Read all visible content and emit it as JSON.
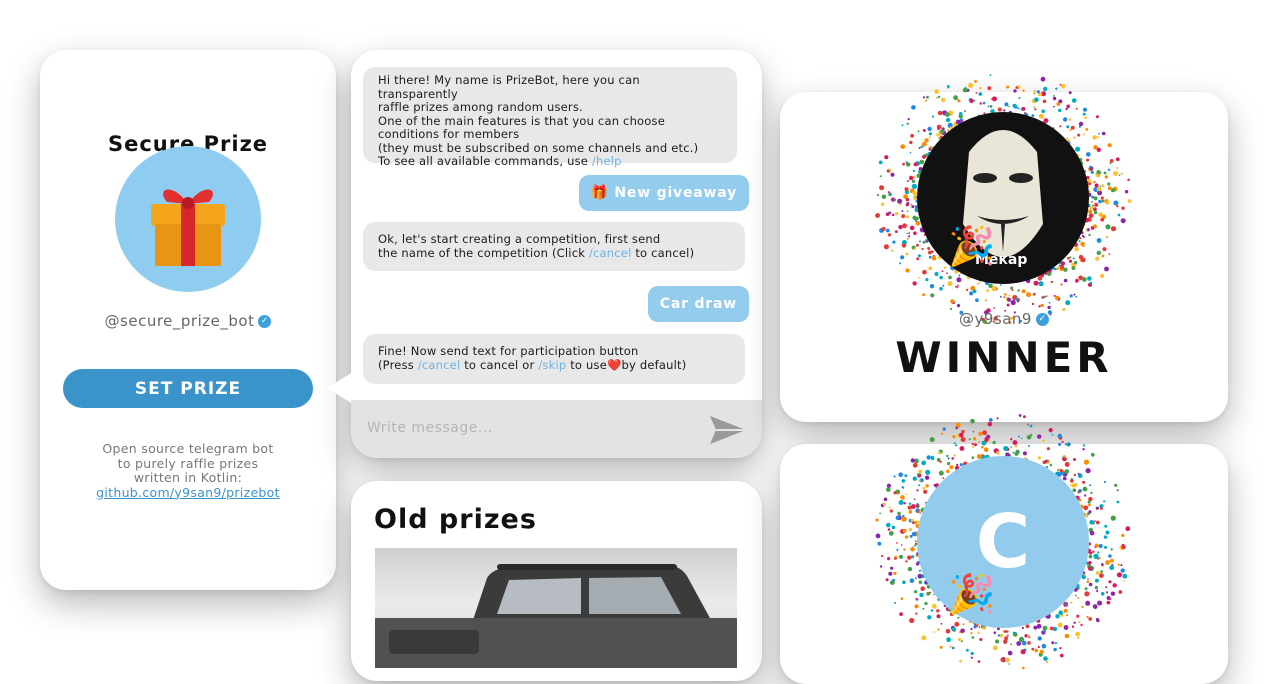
{
  "profile": {
    "title": "Secure Prize",
    "handle": "@secure_prize_bot",
    "set_prize_label": "SET PRIZE",
    "description_lines": [
      "Open source telegram bot",
      "to purely raffle prizes",
      "written in Kotlin:"
    ],
    "link": "github.com/y9san9/prizebot"
  },
  "chat": {
    "welcome": {
      "line1": "Hi there! My name is PrizeBot, here you can transparently",
      "line2": "raffle prizes among random users.",
      "line3": "One of the main features is that you can choose",
      "line4": "conditions for members",
      "line5": "(they must be subscribed on some channels and etc.)",
      "line6_pre": "To see all available commands, use ",
      "line6_cmd": "/help"
    },
    "new_giveaway": "🎁 New giveaway",
    "prompt_name": {
      "line1": "Ok, let's start creating a competition, first send",
      "line2_pre": "the name of the competition (Click ",
      "line2_cmd": "/cancel",
      "line2_post": " to cancel)"
    },
    "car_draw": "Car draw",
    "prompt_text": {
      "line1": "Fine! Now send text for participation button",
      "line2_pre": "(Press ",
      "cmd_cancel": "/cancel",
      "line2_mid": " to cancel or ",
      "cmd_skip": "/skip",
      "line2_post": " to use❤️by default)"
    },
    "input_placeholder": "Write message..."
  },
  "old_prizes": {
    "title": "Old prizes"
  },
  "winner": {
    "handle": "@y9san9",
    "label": "WINNER",
    "avatar_caption": "Мекар"
  },
  "second_winner": {
    "avatar_letter": "C"
  },
  "colors": {
    "accent": "#3a93c9",
    "outgoing_bubble": "#93ccec",
    "incoming_bubble": "#e8e8e8",
    "avatar_bg": "#8ecdf0"
  },
  "icons": [
    "gift-icon",
    "verified-icon",
    "send-icon",
    "party-popper-icon"
  ]
}
